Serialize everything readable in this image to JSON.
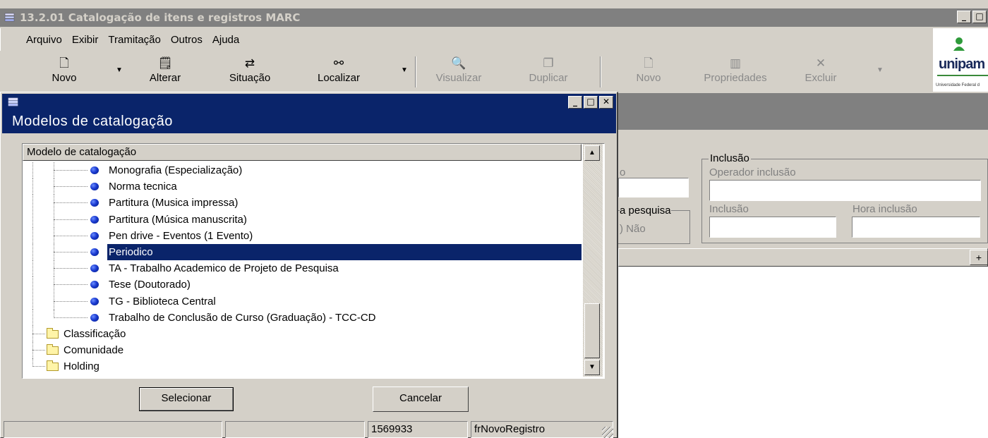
{
  "main_window": {
    "title": "13.2.01 Catalogação de itens e registros MARC",
    "menu": [
      "Arquivo",
      "Exibir",
      "Tramitação",
      "Outros",
      "Ajuda"
    ],
    "toolbar": [
      {
        "label": "Novo",
        "icon": "new-document-icon",
        "enabled": true
      },
      {
        "label": "Alterar",
        "icon": "edit-properties-icon",
        "enabled": true
      },
      {
        "label": "Situação",
        "icon": "status-swap-icon",
        "enabled": true
      },
      {
        "label": "Localizar",
        "icon": "binoculars-icon",
        "enabled": true
      },
      {
        "label": "Visualizar",
        "icon": "magnifier-icon",
        "enabled": false
      },
      {
        "label": "Duplicar",
        "icon": "duplicate-icon",
        "enabled": false
      },
      {
        "label": "Novo",
        "icon": "new-document-icon",
        "enabled": false
      },
      {
        "label": "Propriedades",
        "icon": "properties-icon",
        "enabled": false
      },
      {
        "label": "Excluir",
        "icon": "delete-x-icon",
        "enabled": false
      }
    ],
    "logo_text": "unipam",
    "logo_subtext": "Universidade Federal d"
  },
  "background_form": {
    "fragment_label_1": "o",
    "fragment_label_2": "a pesquisa",
    "fragment_label_3": ") Não",
    "inclusao_group": "Inclusão",
    "operador_inclusao_label": "Operador inclusão",
    "inclusao_label": "Inclusão",
    "hora_inclusao_label": "Hora inclusão",
    "grid_plus": "+"
  },
  "dialog": {
    "subtitle": "Modelos de catalogação",
    "tree_header": "Modelo de catalogação",
    "items": [
      {
        "label": "Monografia (Especialização)",
        "type": "leaf",
        "selected": false
      },
      {
        "label": "Norma tecnica",
        "type": "leaf",
        "selected": false
      },
      {
        "label": "Partitura (Musica impressa)",
        "type": "leaf",
        "selected": false
      },
      {
        "label": "Partitura (Música manuscrita)",
        "type": "leaf",
        "selected": false
      },
      {
        "label": "Pen drive - Eventos (1 Evento)",
        "type": "leaf",
        "selected": false
      },
      {
        "label": "Periodico",
        "type": "leaf",
        "selected": true
      },
      {
        "label": "TA - Trabalho Academico de Projeto de Pesquisa",
        "type": "leaf",
        "selected": false
      },
      {
        "label": "Tese (Doutorado)",
        "type": "leaf",
        "selected": false
      },
      {
        "label": "TG - Biblioteca Central",
        "type": "leaf",
        "selected": false
      },
      {
        "label": "Trabalho de Conclusão de Curso (Graduação) - TCC-CD",
        "type": "leaf",
        "selected": false
      },
      {
        "label": "Classificação",
        "type": "folder",
        "selected": false
      },
      {
        "label": "Comunidade",
        "type": "folder",
        "selected": false
      },
      {
        "label": "Holding",
        "type": "folder",
        "selected": false
      }
    ],
    "select_button": "Selecionar",
    "cancel_button": "Cancelar",
    "status": [
      "",
      "",
      "1569933",
      "frNovoRegistro"
    ]
  },
  "colors": {
    "face": "#d4d0c8",
    "active_title": "#0a246a",
    "inactive_title": "#808080",
    "selection": "#0a246a"
  }
}
